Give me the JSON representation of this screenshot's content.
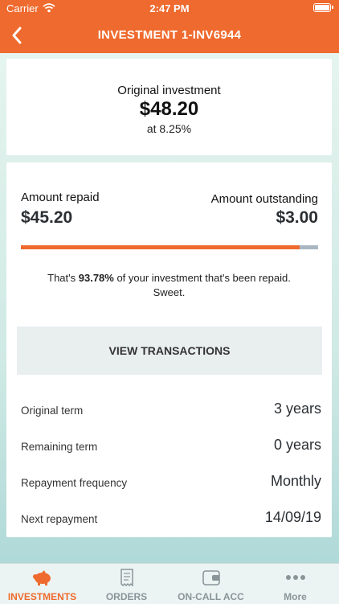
{
  "status_bar": {
    "carrier": "Carrier",
    "time": "2:47 PM"
  },
  "header": {
    "title": "INVESTMENT 1-INV6944",
    "back_icon": "chevron-left-icon"
  },
  "original": {
    "label": "Original investment",
    "amount": "$48.20",
    "rate": "at 8.25%"
  },
  "repayment": {
    "repaid_label": "Amount repaid",
    "repaid_value": "$45.20",
    "outstanding_label": "Amount outstanding",
    "outstanding_value": "$3.00",
    "progress_fraction": 0.9378,
    "summary_prefix": "That's ",
    "summary_percent": "93.78%",
    "summary_suffix": " of your investment that's been repaid. Sweet."
  },
  "view_transactions_label": "VIEW TRANSACTIONS",
  "details": [
    {
      "label": "Original term",
      "value": "3 years"
    },
    {
      "label": "Remaining term",
      "value": "0 years"
    },
    {
      "label": "Repayment frequency",
      "value": "Monthly"
    },
    {
      "label": "Next repayment",
      "value": "14/09/19"
    }
  ],
  "tabs": [
    {
      "label": "INVESTMENTS",
      "icon": "piggy-bank-icon",
      "active": true
    },
    {
      "label": "ORDERS",
      "icon": "receipt-icon",
      "active": false
    },
    {
      "label": "ON-CALL ACC",
      "icon": "wallet-icon",
      "active": false
    },
    {
      "label": "More",
      "icon": "more-dots-icon",
      "active": false
    }
  ],
  "colors": {
    "accent": "#ef6a2e",
    "progress_track": "#a9b6c2",
    "tab_inactive": "#8a9599"
  }
}
